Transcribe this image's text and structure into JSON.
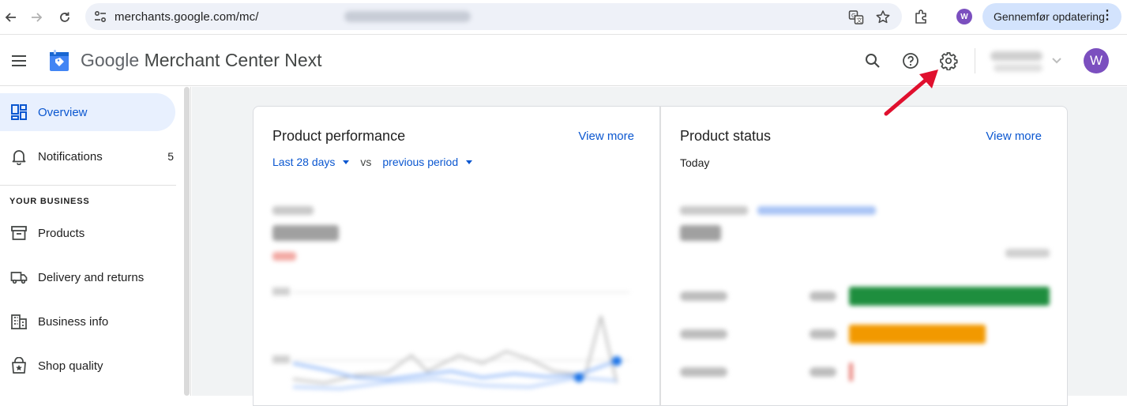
{
  "browser": {
    "url": "merchants.google.com/mc/",
    "profile_initial": "W",
    "update_button": "Gennemfør opdatering"
  },
  "header": {
    "title_google": "Google",
    "title_rest": "Merchant Center Next",
    "avatar_initial": "W"
  },
  "sidebar": {
    "items": [
      {
        "label": "Overview",
        "icon": "overview-icon",
        "active": true
      },
      {
        "label": "Notifications",
        "icon": "bell-icon",
        "count": "5"
      },
      {
        "label": "Products",
        "icon": "archive-box-icon"
      },
      {
        "label": "Delivery and returns",
        "icon": "truck-icon"
      },
      {
        "label": "Business info",
        "icon": "building-icon"
      },
      {
        "label": "Shop quality",
        "icon": "shop-badge-icon"
      }
    ],
    "section_label": "YOUR BUSINESS"
  },
  "performance_card": {
    "title": "Product performance",
    "view_more": "View more",
    "period": "Last 28 days",
    "vs": "vs",
    "compare": "previous period"
  },
  "status_card": {
    "title": "Product status",
    "view_more": "View more",
    "subtitle": "Today"
  },
  "colors": {
    "accent_blue": "#0b57d0",
    "approved_green": "#1e8e3e",
    "limited_orange": "#f29900",
    "not_approved_red": "#d93025",
    "annotation_arrow": "#e0102e"
  },
  "status_bars": [
    {
      "status": "approved",
      "fraction": 1.0
    },
    {
      "status": "limited",
      "fraction": 0.68
    },
    {
      "status": "not_approved",
      "fraction": 0.02
    }
  ]
}
